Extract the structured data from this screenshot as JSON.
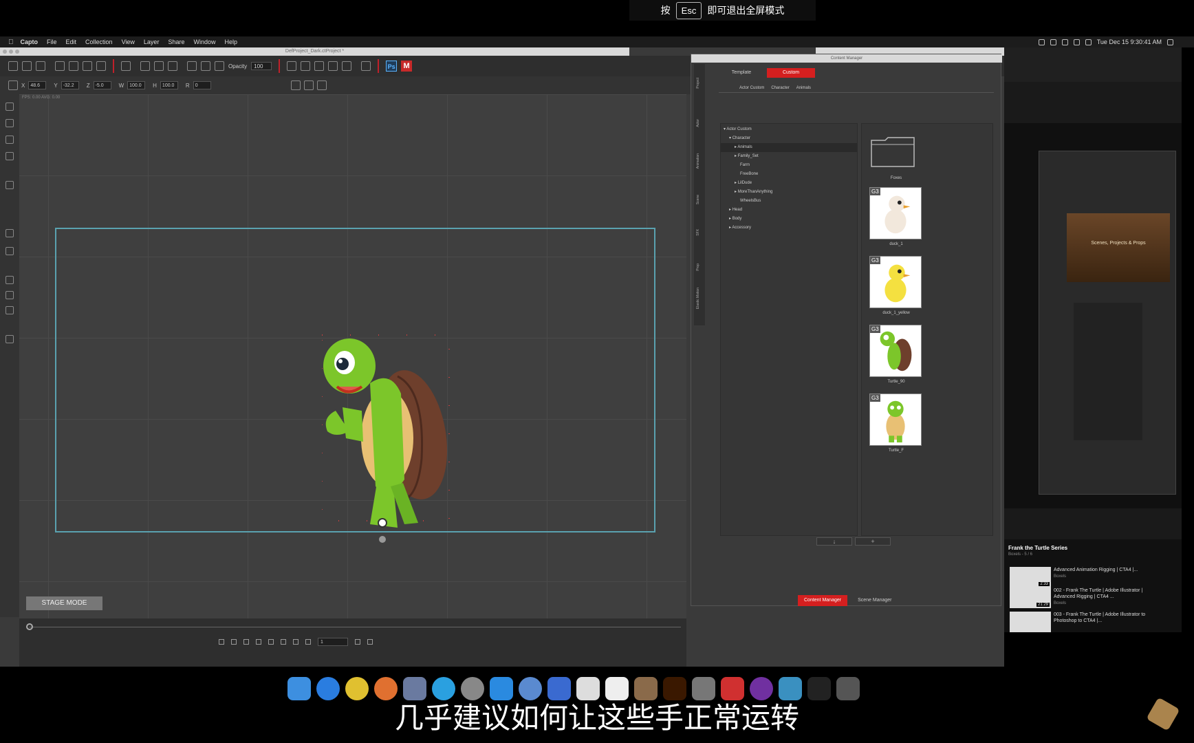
{
  "menubar": {
    "apple": "⌘",
    "app_name": "Capto",
    "items": [
      "File",
      "Edit",
      "Collection",
      "View",
      "Layer",
      "Share",
      "Window",
      "Help"
    ],
    "clock": "Tue Dec 15  9:30:41 AM"
  },
  "window": {
    "title": "DefProject_Dark.ctProject *"
  },
  "esc_banner": {
    "prefix": "按",
    "key": "Esc",
    "suffix": "即可退出全屏模式"
  },
  "toolbar": {
    "opacity_label": "Opacity",
    "opacity_value": "100",
    "ps_label": "Ps",
    "m_label": "M"
  },
  "transform": {
    "x_label": "X",
    "x_value": "48.6",
    "y_label": "Y",
    "y_value": "-32.2",
    "z_label": "Z",
    "z_value": "-5.0",
    "w_label": "W",
    "w_value": "100.0",
    "h_label": "H",
    "h_value": "100.0",
    "r_label": "R",
    "r_value": "0"
  },
  "stage": {
    "info": "FPS: 0.00  AVG: 0.00",
    "mode_button": "STAGE MODE"
  },
  "timeline": {
    "frame": "1"
  },
  "content_manager": {
    "title": "Content Manager",
    "tabs": [
      "Template",
      "Custom"
    ],
    "active_tab": "Custom",
    "vertical_tabs": [
      "Project",
      "Actor",
      "Animation",
      "Scene",
      "SFX",
      "Prop",
      "Elastic Motion"
    ],
    "breadcrumb": [
      "Actor Custom",
      "Character",
      "Animals"
    ],
    "tree": [
      {
        "label": "Actor Custom",
        "prefix": "▾"
      },
      {
        "label": "Character",
        "prefix": "▾"
      },
      {
        "label": "Animals",
        "prefix": "▸"
      },
      {
        "label": "Family_Set",
        "prefix": "▸"
      },
      {
        "label": "Farm",
        "prefix": ""
      },
      {
        "label": "FreeBone",
        "prefix": ""
      },
      {
        "label": "LilDude",
        "prefix": "▸"
      },
      {
        "label": "MoreThanAnything",
        "prefix": "▸"
      },
      {
        "label": "WheelsBus",
        "prefix": ""
      },
      {
        "label": "Head",
        "prefix": "▸"
      },
      {
        "label": "Body",
        "prefix": "▸"
      },
      {
        "label": "Accessory",
        "prefix": "▸"
      }
    ],
    "folder_name": "Foxes",
    "items": [
      {
        "badge": "G3",
        "name": "duck_1"
      },
      {
        "badge": "G3",
        "name": "duck_1_yellow"
      },
      {
        "badge": "G3",
        "name": "Turtle_90"
      },
      {
        "badge": "G3",
        "name": "Turtle_F"
      }
    ],
    "footer_down": "↓",
    "footer_add": "+",
    "bottom_tabs": [
      "Content Manager",
      "Scene Manager"
    ]
  },
  "browser": {
    "nested_banner": "Scenes, Projects & Props",
    "playlist_title": "Frank the Turtle Series",
    "playlist_sub": "Boxels - 5 / 6",
    "videos": [
      {
        "title": "Advanced Animation Rigging | CTA4 |...",
        "channel": "Boxels",
        "duration": "2:33"
      },
      {
        "title": "002 - Frank The Turtle | Adobe Illustrator | Advanced Rigging | CTA4 ...",
        "channel": "Boxels",
        "duration": "21:29"
      },
      {
        "title": "003 - Frank The Turtle | Adobe Illustrator to Photoshop to CTA4 |...",
        "channel": "",
        "duration": ""
      }
    ]
  },
  "subtitle": "几乎建议如何让这些手正常运转",
  "colors": {
    "accent_red": "#d51f1f",
    "stage_frame": "#5aa2b0",
    "turtle_green": "#7cc62a",
    "shell_brown": "#6e3f2c"
  }
}
